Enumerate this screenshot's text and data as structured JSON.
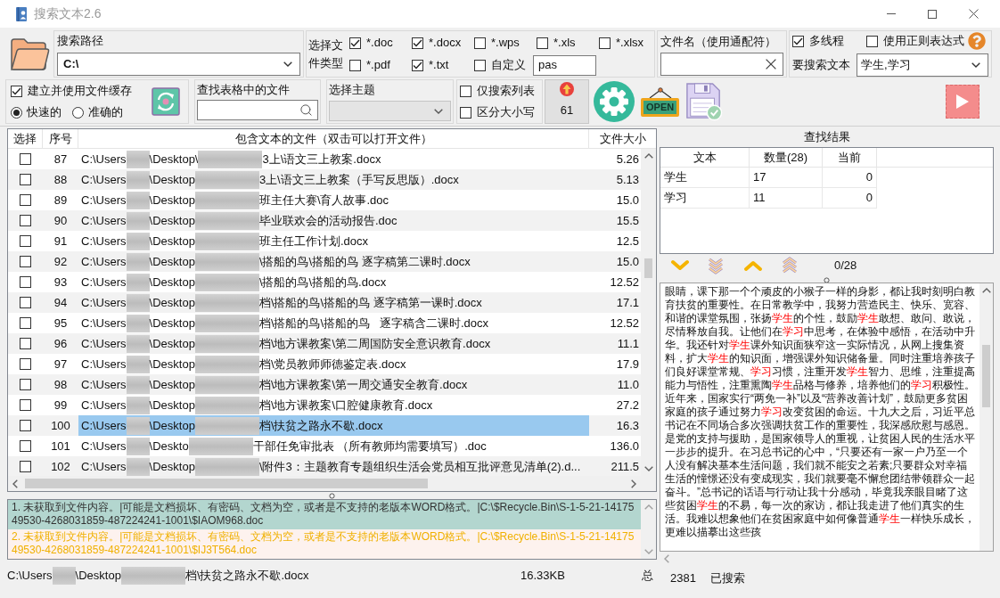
{
  "window": {
    "title": "搜索文本2.6"
  },
  "search_path": {
    "label": "搜索路径",
    "value": "C:\\"
  },
  "file_types": {
    "label": "选择文件类型",
    "options": [
      {
        "label": "*.doc",
        "checked": true
      },
      {
        "label": "*.docx",
        "checked": true
      },
      {
        "label": "*.wps",
        "checked": false
      },
      {
        "label": "*.xls",
        "checked": false
      },
      {
        "label": "*.xlsx",
        "checked": false
      },
      {
        "label": "*.pdf",
        "checked": false
      },
      {
        "label": "*.txt",
        "checked": true
      },
      {
        "label": "自定义",
        "checked": false
      }
    ],
    "custom_value": "pas"
  },
  "file_name": {
    "label": "文件名（使用通配符）"
  },
  "search_options": [
    {
      "label": "多线程",
      "checked": true
    },
    {
      "label": "使用正则表达式",
      "checked": false
    }
  ],
  "search_text": {
    "label": "要搜索文本",
    "value": "学生,学习"
  },
  "cache": {
    "label": "建立并使用文件缓存",
    "checked": true,
    "modes": [
      {
        "label": "快速的",
        "selected": true
      },
      {
        "label": "准确的",
        "selected": false
      }
    ]
  },
  "table_filter": {
    "label": "查找表格中的文件"
  },
  "theme": {
    "label": "选择主题",
    "disabled": true
  },
  "filters": [
    {
      "label": "仅搜索列表",
      "checked": false
    },
    {
      "label": "区分大小写",
      "checked": false
    }
  ],
  "counter": {
    "value": "61"
  },
  "open_button": {
    "label": "OPEN"
  },
  "table": {
    "columns": [
      "选择",
      "序号",
      "包含文本的文件（双击可以打开文件）",
      "文件大小"
    ],
    "rows": [
      {
        "checked": false,
        "index": "87",
        "path": [
          "C:\\Users",
          "\\Desktop\\",
          "3上\\语文三上教案.docx"
        ],
        "size": "5.26",
        "selected": false
      },
      {
        "checked": false,
        "index": "88",
        "path": [
          "C:\\Users",
          "\\Desktop",
          "3上\\语文三上教案（手写反思版）.docx"
        ],
        "size": "5.13",
        "selected": false
      },
      {
        "checked": false,
        "index": "89",
        "path": [
          "C:\\Users",
          "\\Desktop",
          "班主任大赛\\育人故事.doc"
        ],
        "size": "15.0",
        "selected": false
      },
      {
        "checked": false,
        "index": "90",
        "path": [
          "C:\\Users",
          "\\Desktop",
          "毕业联欢会的活动报告.doc"
        ],
        "size": "15.5",
        "selected": false
      },
      {
        "checked": false,
        "index": "91",
        "path": [
          "C:\\Users",
          "\\Desktop",
          "班主任工作计划.docx"
        ],
        "size": "12.5",
        "selected": false
      },
      {
        "checked": false,
        "index": "92",
        "path": [
          "C:\\Users",
          "\\Desktop",
          "\\搭船的鸟\\搭船的鸟 逐字稿第二课时.docx"
        ],
        "size": "15.0",
        "selected": false
      },
      {
        "checked": false,
        "index": "93",
        "path": [
          "C:\\Users",
          "\\Desktop",
          "\\搭船的鸟\\搭船的鸟.docx"
        ],
        "size": "12.52",
        "selected": false
      },
      {
        "checked": false,
        "index": "94",
        "path": [
          "C:\\Users",
          "\\Desktop",
          "档\\搭船的鸟\\搭船的鸟 逐字稿第一课时.docx"
        ],
        "size": "17.1",
        "selected": false
      },
      {
        "checked": false,
        "index": "95",
        "path": [
          "C:\\Users",
          "\\Desktop",
          "档\\搭船的鸟\\搭船的鸟   逐字稿含二课时.docx"
        ],
        "size": "12.52",
        "selected": false
      },
      {
        "checked": false,
        "index": "96",
        "path": [
          "C:\\Users",
          "\\Desktop",
          "档\\地方课教案\\第二周国防安全意识教育.docx"
        ],
        "size": "11.1",
        "selected": false
      },
      {
        "checked": false,
        "index": "97",
        "path": [
          "C:\\Users",
          "\\Desktop",
          "档\\党员教师师德鉴定表.docx"
        ],
        "size": "17.9",
        "selected": false
      },
      {
        "checked": false,
        "index": "98",
        "path": [
          "C:\\Users",
          "\\Desktop",
          "档\\地方课教案\\第一周交通安全教育.docx"
        ],
        "size": "11.0",
        "selected": false
      },
      {
        "checked": false,
        "index": "99",
        "path": [
          "C:\\Users",
          "\\Desktop",
          "档\\地方课教案\\口腔健康教育.docx"
        ],
        "size": "27.2",
        "selected": false
      },
      {
        "checked": false,
        "index": "100",
        "path": [
          "C:\\Users",
          "\\Desktop",
          "档\\扶贫之路永不歇.docx"
        ],
        "size": "16.3",
        "selected": true
      },
      {
        "checked": false,
        "index": "101",
        "path": [
          "C:\\Users",
          "\\Deskto",
          "干部任免审批表 （所有教师均需要填写）.doc"
        ],
        "size": "136.0",
        "selected": false
      },
      {
        "checked": false,
        "index": "102",
        "path": [
          "C:\\Users",
          "\\Desktop",
          "\\附件3：主题教育专题组织生活会党员相互批评意见清单(2).d..."
        ],
        "size": "211.5",
        "selected": false
      }
    ]
  },
  "messages": [
    {
      "text": "1. 未获取到文件内容。|可能是文档损坏、有密码、文档为空，或者是不支持的老版本WORD格式。|C:\\$Recycle.Bin\\S-1-5-21-1417549530-4268031859-487224241-1001\\$IAOM968.doc",
      "selected": true
    },
    {
      "text": "2. 未获取到文件内容。|可能是文档损坏、有密码、文档为空，或者是不支持的老版本WORD格式。|C:\\$Recycle.Bin\\S-1-5-21-1417549530-4268031859-487224241-1001\\$IJ3T564.doc",
      "selected": false
    }
  ],
  "status_bar": {
    "path": [
      "C:\\Users",
      "\\Desktop",
      "档\\扶贫之路永不歇.docx"
    ],
    "size": "16.33KB",
    "total": "总"
  },
  "results": {
    "title": "查找结果",
    "columns": [
      "文本",
      "数量(28)",
      "当前"
    ],
    "rows": [
      {
        "text": "学生",
        "count": "17",
        "current": "0"
      },
      {
        "text": "学习",
        "count": "11",
        "current": "0"
      }
    ],
    "position": "0/28"
  },
  "preview": {
    "segments": [
      {
        "text": "眼睛，课下那一个个顽皮的小猴子一样的身影，都让我时刻明白教育扶贫的重要性。在日常教学中，我努力营造民主、快乐、宽容、和谐的课堂氛围，张扬",
        "highlight": false
      },
      {
        "text": "学生",
        "highlight": true
      },
      {
        "text": "的个性，鼓励",
        "highlight": false
      },
      {
        "text": "学生",
        "highlight": true
      },
      {
        "text": "敢想、敢问、敢说，尽情释放自我。让他们在",
        "highlight": false
      },
      {
        "text": "学习",
        "highlight": true
      },
      {
        "text": "中思考，在体验中感悟，在活动中升华。我还针对",
        "highlight": false
      },
      {
        "text": "学生",
        "highlight": true
      },
      {
        "text": "课外知识面狭窄这一实际情况，从网上搜集资料，扩大",
        "highlight": false
      },
      {
        "text": "学生",
        "highlight": true
      },
      {
        "text": "的知识面，增强课外知识储备量。同时注重培养孩子们良好课堂常规、",
        "highlight": false
      },
      {
        "text": "学习",
        "highlight": true
      },
      {
        "text": "习惯，注重开发",
        "highlight": false
      },
      {
        "text": "学生",
        "highlight": true
      },
      {
        "text": "智力、思维，注重提高能力与悟性，注重熏陶",
        "highlight": false
      },
      {
        "text": "学生",
        "highlight": true
      },
      {
        "text": "品格与修养，培养他们的",
        "highlight": false
      },
      {
        "text": "学习",
        "highlight": true
      },
      {
        "text": "积极性。近年来，国家实行“两免一补”以及“营养改善计划”，鼓励更多贫困家庭的孩子通过努力",
        "highlight": false
      },
      {
        "text": "学习",
        "highlight": true
      },
      {
        "text": "改变贫困的命运。十九大之后，习近平总书记在不同场合多次强调扶贫工作的重要性，我深感欣慰与感恩。是党的支持与援助，是国家领导人的重视，让贫困人民的生活水平一步步的提升。在习总书记的心中，“只要还有一家一户乃至一个人没有解决基本生活问题，我们就不能安之若素;只要群众对幸福生活的憧憬还没有变成现实，我们就要毫不懈怠团结带领群众一起奋斗。”总书记的话语与行动让我十分感动，毕竟我亲眼目睹了这些贫困",
        "highlight": false
      },
      {
        "text": "学生",
        "highlight": true
      },
      {
        "text": "的不易，每一次的家访，都让我走进了他们真实的生活。我难以想象他们在贫困家庭中如何像普通",
        "highlight": false
      },
      {
        "text": "学生",
        "highlight": true
      },
      {
        "text": "一样快乐成长，更难以描摹出这些孩",
        "highlight": false
      }
    ]
  },
  "progress": {
    "count": "2381",
    "label": "已搜索"
  }
}
